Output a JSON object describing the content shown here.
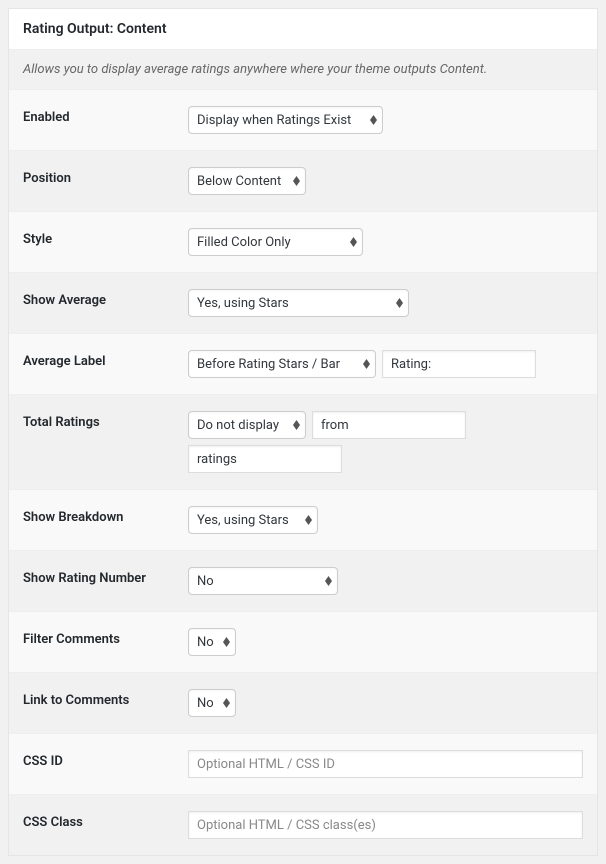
{
  "header": {
    "title": "Rating Output: Content"
  },
  "description": "Allows you to display average ratings anywhere where your theme outputs Content.",
  "rows": {
    "enabled": {
      "label": "Enabled",
      "value": "Display when Ratings Exist"
    },
    "position": {
      "label": "Position",
      "value": "Below Content"
    },
    "style": {
      "label": "Style",
      "value": "Filled Color Only"
    },
    "show_average": {
      "label": "Show Average",
      "value": "Yes, using Stars"
    },
    "average_label": {
      "label": "Average Label",
      "select_value": "Before Rating Stars / Bar",
      "input_value": "Rating:"
    },
    "total_ratings": {
      "label": "Total Ratings",
      "select_value": "Do not display",
      "input1_value": "from",
      "input2_value": "ratings"
    },
    "show_breakdown": {
      "label": "Show Breakdown",
      "value": "Yes, using Stars"
    },
    "show_rating_number": {
      "label": "Show Rating Number",
      "value": "No"
    },
    "filter_comments": {
      "label": "Filter Comments",
      "value": "No"
    },
    "link_to_comments": {
      "label": "Link to Comments",
      "value": "No"
    },
    "css_id": {
      "label": "CSS ID",
      "placeholder": "Optional HTML / CSS ID"
    },
    "css_class": {
      "label": "CSS Class",
      "placeholder": "Optional HTML / CSS class(es)"
    }
  }
}
